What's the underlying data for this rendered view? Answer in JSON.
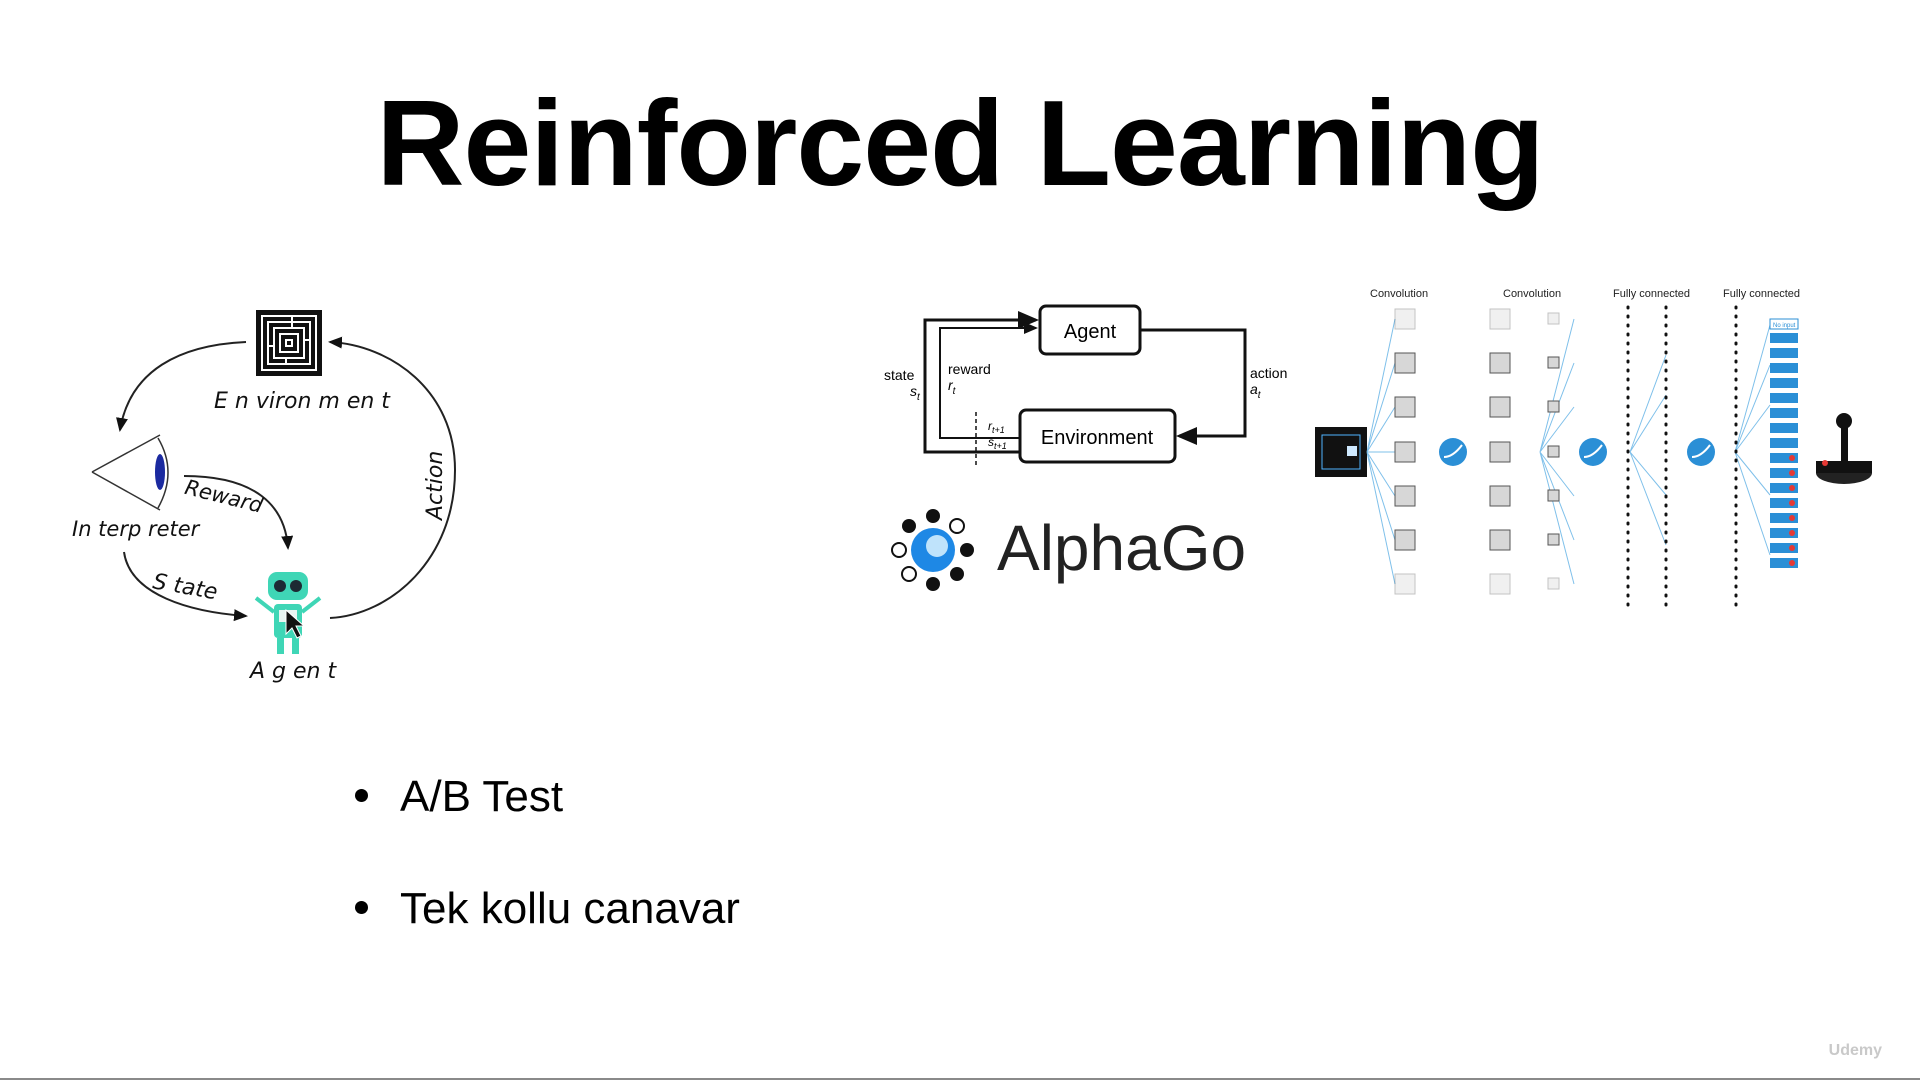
{
  "slide": {
    "title": "Reinforced Learning"
  },
  "rl_cycle_diagram": {
    "environment_label": "E n viron m en t",
    "interpreter_label": "In terp reter",
    "agent_label": "A g en t",
    "reward_label": "Reward",
    "state_label": "S tate",
    "action_label": "Action",
    "icons": [
      "maze-icon",
      "eye-icon",
      "robot-icon",
      "cursor-icon"
    ]
  },
  "agent_env_diagram": {
    "agent_box": "Agent",
    "environment_box": "Environment",
    "state_label": "state",
    "state_symbol": "s",
    "state_sub": "t",
    "reward_label": "reward",
    "reward_symbol": "r",
    "reward_sub": "t",
    "action_label": "action",
    "action_symbol": "a",
    "action_sub": "t",
    "next_reward_symbol": "r",
    "next_reward_sub": "t+1",
    "next_state_symbol": "s",
    "next_state_sub": "t+1"
  },
  "alphago": {
    "logo_text": "AlphaGo"
  },
  "dqn_diagram": {
    "layers": [
      "Convolution",
      "Convolution",
      "Fully connected",
      "Fully connected"
    ],
    "output_top_label": "No input",
    "icons": [
      "game-screen-icon",
      "activation-icon",
      "joystick-icon"
    ],
    "accent_color": "#2b8fd6"
  },
  "bullets": [
    "A/B Test",
    "Tek kollu canavar"
  ],
  "watermark": "Udemy"
}
